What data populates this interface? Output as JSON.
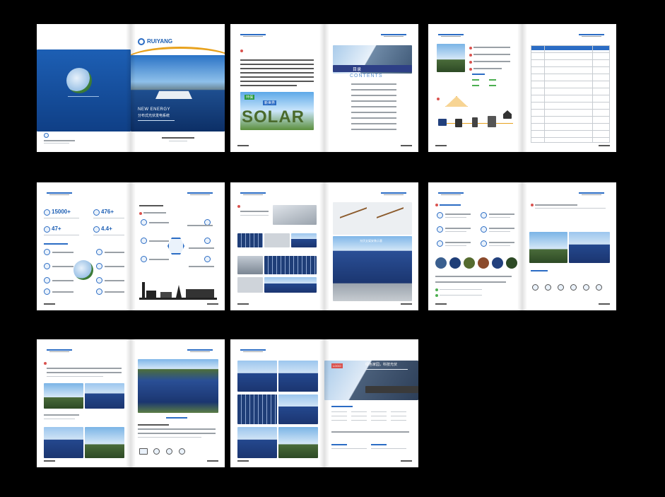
{
  "cover": {
    "brand": "RUIYANG",
    "tagline_en": "NEW ENERGY",
    "tagline_cn": "分布式光伏发电系统"
  },
  "spread2": {
    "banner_small": "环保",
    "banner_small2": "新世界",
    "solar_word": "SOLAR",
    "toc_cn": "目录",
    "toc_en": "CONTENTS"
  },
  "spread4": {
    "stats": [
      {
        "value": "15000",
        "suffix": "+"
      },
      {
        "value": "476",
        "suffix": "+"
      },
      {
        "value": "47",
        "suffix": "+"
      },
      {
        "value": "4.4",
        "suffix": "+"
      }
    ]
  },
  "spread5": {
    "overlay_title": "光伏支架安装示意"
  },
  "spread8": {
    "logo": "LOGO",
    "headline": "绿色家园，科技光伏"
  },
  "colors": {
    "accent": "#2b6cc4",
    "cover_blue": "#1d5fb4",
    "dot_red": "#d9534f",
    "background": "#000000"
  }
}
